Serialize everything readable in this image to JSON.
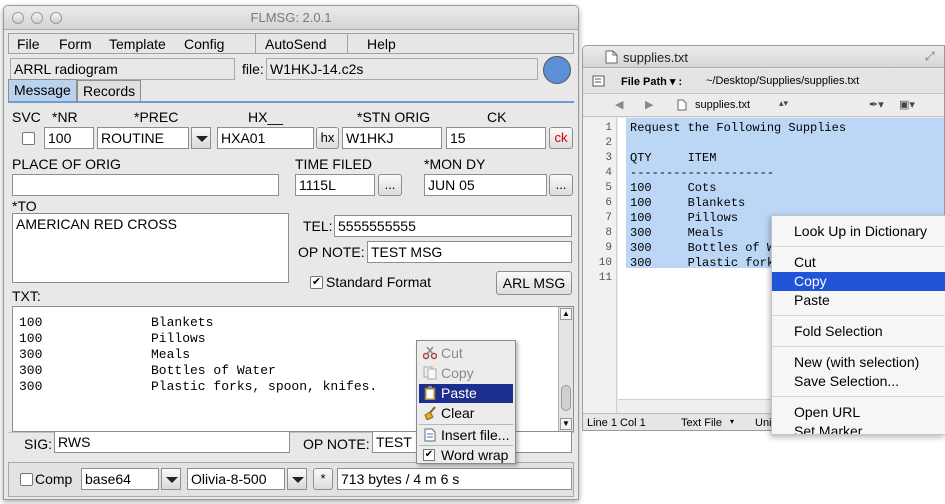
{
  "flmsg": {
    "title": "FLMSG: 2.0.1",
    "menu": {
      "file": "File",
      "form": "Form",
      "template": "Template",
      "config": "Config",
      "autosend": "AutoSend",
      "help": "Help"
    },
    "form_name": "ARRL radiogram",
    "file_label": "file:",
    "file_value": "W1HKJ-14.c2s",
    "tabs": [
      "Message",
      "Records"
    ],
    "fields": {
      "svc_label": "SVC",
      "nr_label": "*NR",
      "nr_value": "100",
      "prec_label": "*PREC",
      "prec_value": "ROUTINE",
      "hx_label": "HX__",
      "hx_value": "HXA01",
      "hx_button": "hx",
      "stn_orig_label": "*STN ORIG",
      "stn_orig_value": "W1HKJ",
      "ck_label": "CK",
      "ck_value": "15",
      "ck_button": "ck",
      "place_label": "PLACE OF ORIG",
      "place_value": "",
      "time_label": "TIME FILED",
      "time_value": "1115L",
      "time_button": "...",
      "mon_label": "*MON DY",
      "mon_value": "JUN 05",
      "mon_button": "...",
      "to_label": "*TO",
      "to_value": "AMERICAN RED CROSS",
      "tel_label": "TEL:",
      "tel_value": "5555555555",
      "opnote_label": "OP NOTE:",
      "opnote_value": "TEST MSG",
      "std_format_label": "Standard Format",
      "arl_button": "ARL MSG",
      "txt_label": "TXT:",
      "sig_label": "SIG:",
      "sig_value": "RWS",
      "opnote2_label": "OP NOTE:",
      "opnote2_value": "TEST M"
    },
    "txt_lines": [
      {
        "qty": "100",
        "item": "Blankets"
      },
      {
        "qty": "100",
        "item": "Pillows"
      },
      {
        "qty": "300",
        "item": "Meals"
      },
      {
        "qty": "300",
        "item": "Bottles of Water"
      },
      {
        "qty": "300",
        "item": "Plastic forks, spoon, knifes."
      }
    ],
    "context_menu": [
      "Cut",
      "Copy",
      "Paste",
      "Clear",
      "Insert file...",
      "Word wrap"
    ],
    "bottom": {
      "comp_label": "Comp",
      "encoding": "base64",
      "mode": "Olivia-8-500",
      "star_button": "*",
      "status": "713 bytes / 4 m 6 s"
    }
  },
  "supplies": {
    "title": "supplies.txt",
    "file_path_label": "File Path ▾ :",
    "file_path": "~/Desktop/Supplies/supplies.txt",
    "tab_name": "supplies.txt",
    "lines": [
      "Request the Following Supplies",
      "",
      "QTY     ITEM",
      "--------------------",
      "100     Cots",
      "100     Blankets",
      "100     Pillows",
      "300     Meals",
      "300     Bottles of Water",
      "300     Plastic forks",
      ""
    ],
    "line_numbers": [
      "1",
      "2",
      "3",
      "4",
      "5",
      "6",
      "7",
      "8",
      "9",
      "10",
      "11"
    ],
    "status": {
      "pos": "Line 1 Col 1",
      "mode": "Text File",
      "enc": "Uni"
    }
  },
  "editor_context_menu": [
    "Look Up in Dictionary",
    "Cut",
    "Copy",
    "Paste",
    "Fold Selection",
    "New (with selection)",
    "Save Selection...",
    "Open URL",
    "Set Marker"
  ],
  "colors": {
    "highlight": "#1f55d6",
    "paste_highlight": "#1c2f8f",
    "selection": "#bcd6f6",
    "ck_red": "#d40000"
  }
}
